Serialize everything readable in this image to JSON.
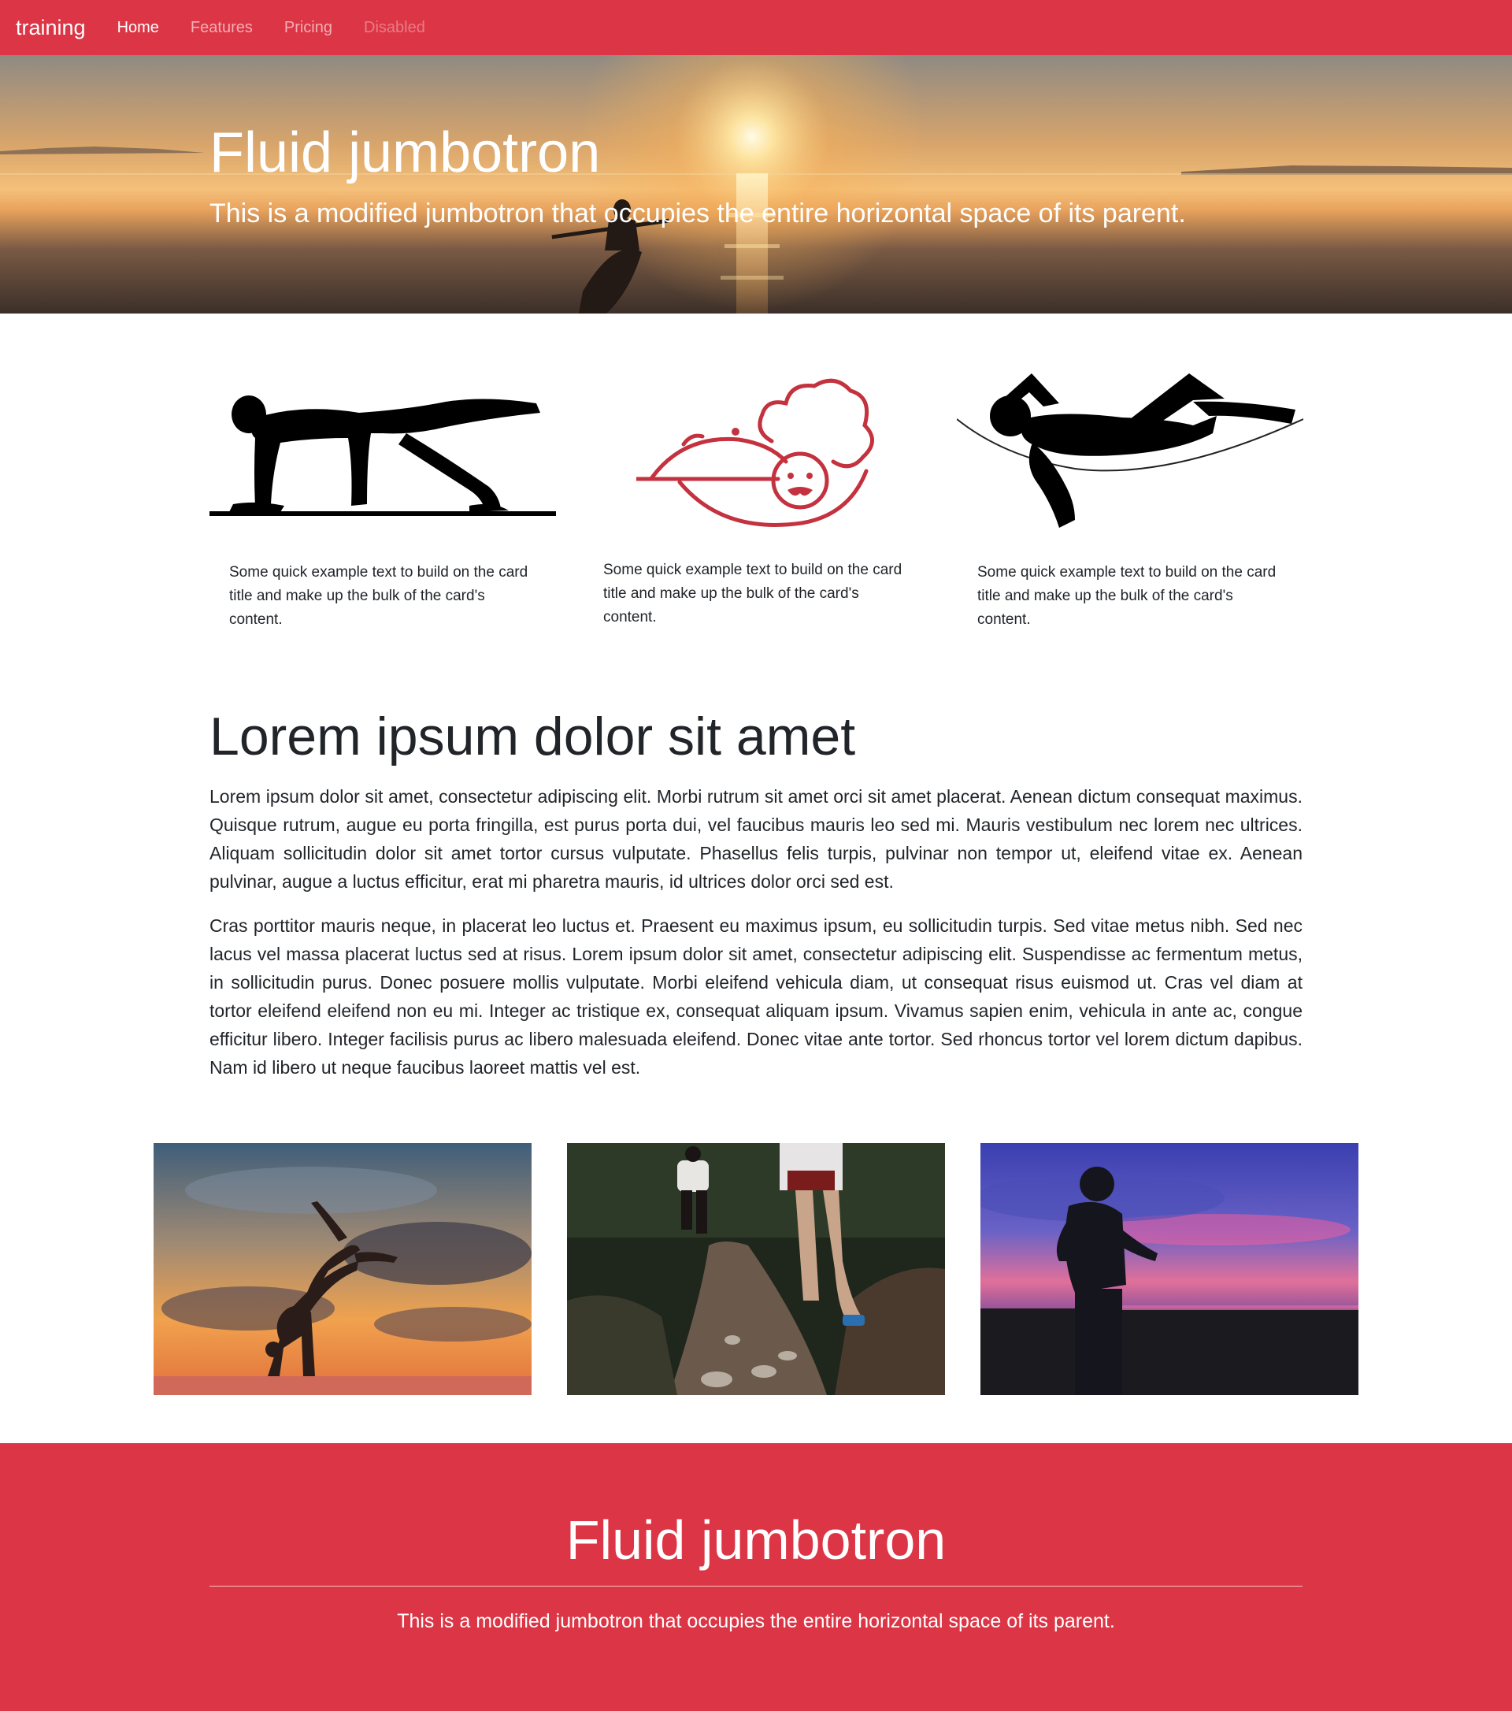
{
  "navbar": {
    "brand": "training",
    "links": [
      {
        "label": "Home",
        "state": "active"
      },
      {
        "label": "Features",
        "state": "normal"
      },
      {
        "label": "Pricing",
        "state": "normal"
      },
      {
        "label": "Disabled",
        "state": "disabled"
      }
    ],
    "color": "#dc3545"
  },
  "hero": {
    "title": "Fluid jumbotron",
    "lead": "This is a modified jumbotron that occupies the entire horizontal space of its parent."
  },
  "cards": [
    {
      "icon": "plank-exercise-icon",
      "text": "Some quick example text to build on the card title and make up the bulk of the card's content."
    },
    {
      "icon": "chef-serving-icon",
      "text": "Some quick example text to build on the card title and make up the bulk of the card's content."
    },
    {
      "icon": "hammock-rest-icon",
      "text": "Some quick example text to build on the card title and make up the bulk of the card's content."
    }
  ],
  "article": {
    "title": "Lorem ipsum dolor sit amet",
    "paragraphs": [
      "Lorem ipsum dolor sit amet, consectetur adipiscing elit. Morbi rutrum sit amet orci sit amet placerat. Aenean dictum consequat maximus. Quisque rutrum, augue eu porta fringilla, est purus porta dui, vel faucibus mauris leo sed mi. Mauris vestibulum nec lorem nec ultrices. Aliquam sollicitudin dolor sit amet tortor cursus vulputate. Phasellus felis turpis, pulvinar non tempor ut, eleifend vitae ex. Aenean pulvinar, augue a luctus efficitur, erat mi pharetra mauris, id ultrices dolor orci sed est.",
      "Cras porttitor mauris neque, in placerat leo luctus et. Praesent eu maximus ipsum, eu sollicitudin turpis. Sed vitae metus nibh. Sed nec lacus vel massa placerat luctus sed at risus. Lorem ipsum dolor sit amet, consectetur adipiscing elit. Suspendisse ac fermentum metus, in sollicitudin purus. Donec posuere mollis vulputate. Morbi eleifend vehicula diam, ut consequat risus euismod ut. Cras vel diam at tortor eleifend eleifend non eu mi. Integer ac tristique ex, consequat aliquam ipsum. Vivamus sapien enim, vehicula in ante ac, congue efficitur libero. Integer facilisis purus ac libero malesuada eleifend. Donec vitae ante tortor. Sed rhoncus tortor vel lorem dictum dapibus. Nam id libero ut neque faucibus laoreet mattis vel est."
    ]
  },
  "photos": [
    {
      "name": "yoga-handstand-photo"
    },
    {
      "name": "trail-runners-photo"
    },
    {
      "name": "sunset-runner-photo"
    }
  ],
  "footer": {
    "title": "Fluid jumbotron",
    "lead": "This is a modified jumbotron that occupies the entire horizontal space of its parent."
  }
}
